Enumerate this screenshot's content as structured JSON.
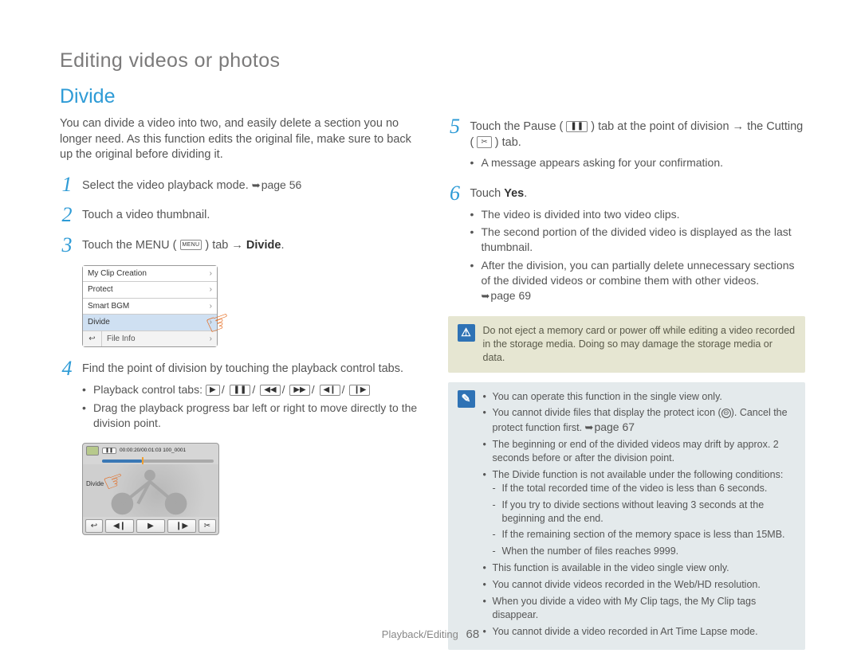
{
  "page_title": "Editing videos or photos",
  "section_title": "Divide",
  "intro": "You can divide a video into two, and easily delete a section you no longer need. As this function edits the original file, make sure to back up the original before dividing it.",
  "steps_left": {
    "s1": {
      "num": "1",
      "text": "Select the video playback mode. ",
      "pageref": "page 56"
    },
    "s2": {
      "num": "2",
      "text": "Touch a video thumbnail."
    },
    "s3": {
      "num": "3",
      "pre": "Touch the MENU (",
      "mid": ") tab → ",
      "bold": "Divide",
      "post": "."
    },
    "s4": {
      "num": "4",
      "text": "Find the point of division by touching the playback control tabs.",
      "bullet1_pre": "Playback control tabs: ",
      "bullet2": "Drag the playback progress bar left or right to move directly to the division point."
    }
  },
  "menu_shot": {
    "items": [
      "My Clip Creation",
      "Protect",
      "Smart BGM",
      "Divide",
      "File Info"
    ],
    "divide_label": "Divide",
    "timecode": "00:00:20/00:01:03  100_0001"
  },
  "steps_right": {
    "s5": {
      "num": "5",
      "pre": "Touch the Pause (",
      "mid1": ") tab at the point of division → the Cutting (",
      "mid2": ") tab.",
      "bullet": "A message appears asking for your confirmation."
    },
    "s6": {
      "num": "6",
      "pre": "Touch ",
      "bold": "Yes",
      "post": ".",
      "b1": "The video is divided into two video clips.",
      "b2": "The second portion of the divided video is displayed as the last thumbnail.",
      "b3": "After the division, you can partially delete unnecessary sections of the divided videos or combine them with other videos. ",
      "pageref": "page 69"
    }
  },
  "warn_note": "Do not eject a memory card or power off while editing a video recorded in the storage media. Doing so may damage the storage media or data.",
  "info_notes": {
    "n1": "You can operate this function in the single view only.",
    "n2_pre": "You cannot divide files that display the protect icon (",
    "n2_post": "). Cancel the protect function first. ",
    "n2_pageref": "page 67",
    "n3": "The beginning or end of the divided videos may drift by approx. 2 seconds before or after the division point.",
    "n4": "The Divide function is not available under the following conditions:",
    "n4a": "If the total recorded time of the video is less than 6 seconds.",
    "n4b": "If you try to divide sections without leaving 3 seconds at the beginning and the end.",
    "n4c": "If the remaining section of the memory space is less than 15MB.",
    "n4d": "When the number of files reaches 9999.",
    "n5": "This function is available in the video single view only.",
    "n6": "You cannot divide videos recorded in the Web/HD resolution.",
    "n7": "When you divide a video with My Clip tags, the My Clip tags disappear.",
    "n8": "You cannot divide a video recorded in Art Time Lapse mode."
  },
  "footer": {
    "section": "Playback/Editing",
    "page": "68"
  },
  "icons": {
    "play": "▶",
    "pause": "❚❚",
    "rew": "◀◀",
    "ffwd": "▶▶",
    "frameback": "◀❙",
    "framefwd": "❙▶",
    "back": "↩",
    "scissors": "✂"
  }
}
